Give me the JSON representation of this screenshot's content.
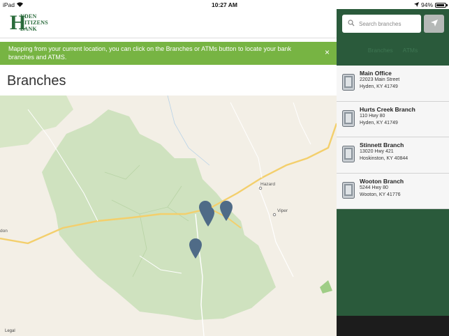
{
  "status_bar": {
    "device": "iPad",
    "time": "10:27 AM",
    "battery": "94%"
  },
  "logo": {
    "letter": "H",
    "line1": "YDEN",
    "line2": "CITIZENS",
    "line3": "BANK"
  },
  "banner": {
    "message": "Mapping from your current location, you can click on the Branches or ATMs button to locate your bank branches and ATMS.",
    "close_label": "×"
  },
  "page_title": "Branches",
  "map": {
    "labels": [
      "Hazard",
      "Viper",
      "don"
    ],
    "legal": "Legal"
  },
  "sidebar": {
    "search_placeholder": "Search branches",
    "tabs": [
      "Branches",
      "ATMs"
    ],
    "branches": [
      {
        "name": "Main Office",
        "street": "22023 Main Street",
        "city": "Hyden, KY 41749"
      },
      {
        "name": "Hurts Creek Branch",
        "street": "110 Hwy 80",
        "city": "Hyden, KY 41749"
      },
      {
        "name": "Stinnett Branch",
        "street": "13020 Hwy 421",
        "city": "Hoskinston, KY 40844"
      },
      {
        "name": "Wooton Branch",
        "street": "5244 Hwy 80",
        "city": "Wooton, KY 41776"
      }
    ]
  },
  "colors": {
    "banner": "#77b443",
    "sidebar": "#2a5a3b",
    "brand": "#2a6b3b",
    "pin": "#4f6b87"
  }
}
